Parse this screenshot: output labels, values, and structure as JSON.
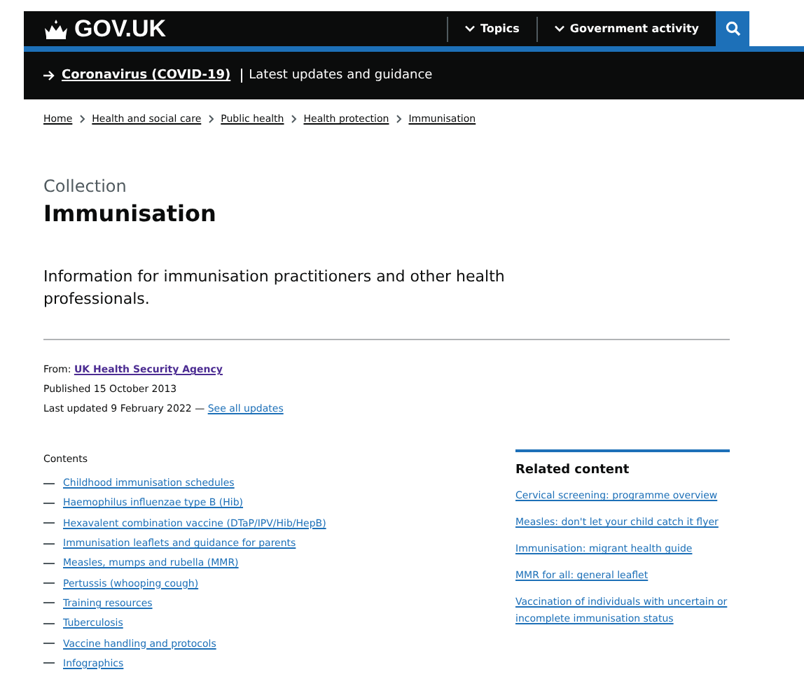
{
  "header": {
    "logo": "GOV.UK",
    "nav": [
      {
        "label": "Topics"
      },
      {
        "label": "Government activity"
      }
    ]
  },
  "banner": {
    "link": "Coronavirus (COVID-19)",
    "text": "Latest updates and guidance"
  },
  "breadcrumbs": [
    "Home",
    "Health and social care",
    "Public health",
    "Health protection",
    "Immunisation"
  ],
  "caption": "Collection",
  "title": "Immunisation",
  "description": "Information for immunisation practitioners and other health professionals.",
  "meta": {
    "from_label": "From:",
    "from_link": "UK Health Security Agency",
    "published": "Published 15 October 2013",
    "updated": "Last updated 9 February 2022 —",
    "updates_link": "See all updates"
  },
  "contents": {
    "heading": "Contents",
    "items": [
      "Childhood immunisation schedules",
      "Haemophilus influenzae type B (Hib)",
      "Hexavalent combination vaccine (DTaP/IPV/Hib/HepB)",
      "Immunisation leaflets and guidance for parents",
      "Measles, mumps and rubella (MMR)",
      "Pertussis (whooping cough)",
      "Training resources",
      "Tuberculosis",
      "Vaccine handling and protocols",
      "Infographics"
    ]
  },
  "related": {
    "heading": "Related content",
    "links": [
      "Cervical screening: programme overview",
      "Measles: don't let your child catch it flyer",
      "Immunisation: migrant health guide",
      "MMR for all: general leaflet",
      "Vaccination of individuals with uncertain or incomplete immunisation status"
    ]
  }
}
